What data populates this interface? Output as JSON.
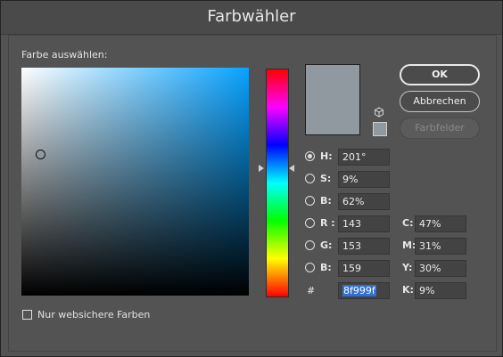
{
  "window": {
    "title": "Farbwähler"
  },
  "picker": {
    "label": "Farbe auswählen:",
    "current_color": "#8f999f",
    "hue_base": "#07a2ff"
  },
  "buttons": {
    "ok": "OK",
    "cancel": "Abbrechen",
    "swatches": "Farbfelder"
  },
  "hsb": [
    {
      "label": "H:",
      "value": "201°",
      "checked": true
    },
    {
      "label": "S:",
      "value": "9%"
    },
    {
      "label": "B:",
      "value": "62%"
    }
  ],
  "rgb": [
    {
      "label": "R :",
      "value": "143"
    },
    {
      "label": "G:",
      "value": "153"
    },
    {
      "label": "B:",
      "value": "159"
    }
  ],
  "cmyk": [
    {
      "label": "C:",
      "value": "47%"
    },
    {
      "label": "M:",
      "value": "31%"
    },
    {
      "label": "Y:",
      "value": "30%"
    },
    {
      "label": "K:",
      "value": "9%"
    }
  ],
  "hex": {
    "symbol": "#",
    "value": "8f999f"
  },
  "websafe": {
    "label": "Nur websichere Farben",
    "checked": false
  },
  "icons": {
    "gamut_warning": "cube-icon"
  }
}
